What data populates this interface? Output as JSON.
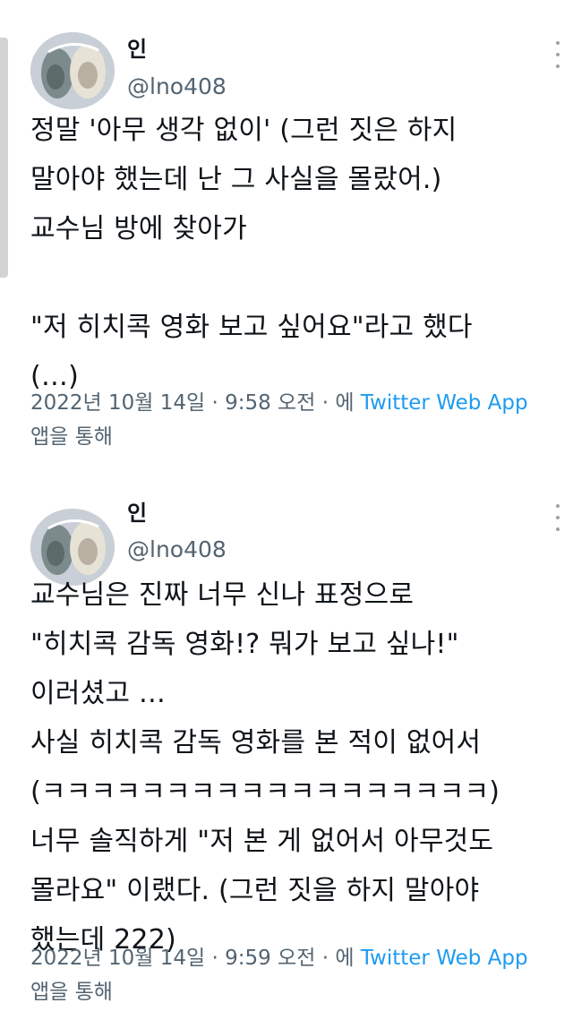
{
  "tweets": [
    {
      "display_name": "인",
      "handle": "@lno408",
      "lines": [
        "정말 '아무 생각 없이' (그런 짓은 하지",
        "말아야 했는데 난 그 사실을 몰랐어.)",
        "교수님 방에 찾아가",
        "",
        "\"저 히치콕 영화 보고 싶어요\"라고 했다",
        "(…)"
      ],
      "timestamp": "2022년 10월 14일 · 9:58 오전 · 에 ",
      "app": "Twitter Web App",
      "via_suffix": "앱을 통해"
    },
    {
      "display_name": "인",
      "handle": "@lno408",
      "lines": [
        "교수님은 진짜 너무 신나 표정으로",
        "\"히치콕 감독 영화!? 뭐가 보고 싶나!\"",
        "이러셨고 …",
        "사실 히치콕 감독 영화를 본 적이 없어서",
        "(ㅋㅋㅋㅋㅋㅋㅋㅋㅋㅋㅋㅋㅋㅋㅋㅋㅋㅋ)",
        "너무 솔직하게 \"저 본 게 없어서 아무것도",
        "몰라요\" 이랬다. (그런 짓을 하지 말아야",
        "했는데 222)"
      ],
      "timestamp": "2022년 10월 14일 · 9:59 오전 · 에 ",
      "app": "Twitter Web App",
      "via_suffix": "앱을 통해"
    }
  ],
  "icons": {
    "more": "more-vertical-icon",
    "avatar": "avatar-image"
  },
  "colors": {
    "text": "#0f1419",
    "secondary": "#536471",
    "link": "#1d9bf0"
  }
}
